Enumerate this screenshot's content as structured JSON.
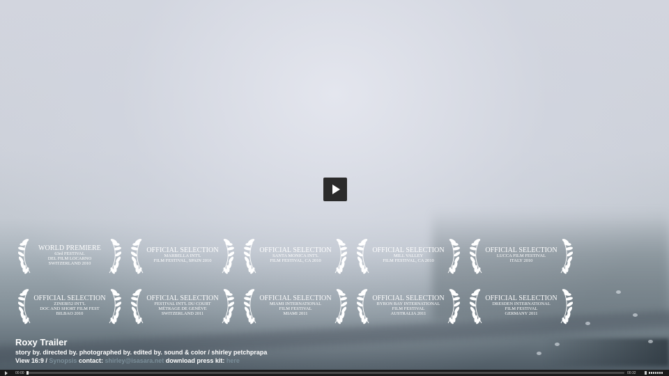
{
  "video": {
    "title": "Roxy Trailer",
    "credits": "story by. directed by. photographed by. edited by. sound & color / shirley petchprapa",
    "view_label": "View 16:9",
    "separator": "/",
    "synopsis_link": "Synopsis",
    "contact_label": "contact:",
    "contact_email": "shirley@isasara.net",
    "presskit_label": "download press kit:",
    "presskit_link": "here"
  },
  "laurels": [
    {
      "head": "WORLD PREMIERE",
      "lines": [
        "63rd FESTIVAL",
        "DEL FILM LOCARNO",
        "SWITZERLAND 2010"
      ]
    },
    {
      "head": "OFFICIAL SELECTION",
      "lines": [
        "MARBELLA INT'L",
        "FILM FESTIVAL, SPAIN 2010"
      ]
    },
    {
      "head": "OFFICIAL SELECTION",
      "lines": [
        "SANTA MONICA INT'L",
        "FILM FESTIVAL, CA 2010"
      ]
    },
    {
      "head": "OFFICIAL SELECTION",
      "lines": [
        "MILL VALLEY",
        "FILM FESTIVAL, CA 2010"
      ]
    },
    {
      "head": "OFFICIAL SELECTION",
      "lines": [
        "LUCCA FILM FESTIVAL",
        "ITALY 2010"
      ]
    },
    {
      "head": "OFFICIAL SELECTION",
      "lines": [
        "ZINEBI52 INT'L",
        "DOC AND SHORT FILM FEST",
        "BILBAO 2010"
      ]
    },
    {
      "head": "OFFICIAL SELECTION",
      "lines": [
        "FESTIVAL INT'L DU COURT",
        "MÉTRAGE DE GENÈVE",
        "SWITZERLAND 2011"
      ]
    },
    {
      "head": "OFFICIAL SELECTION",
      "lines": [
        "MIAMI INTERNATIONAL",
        "FILM FESTIVAL",
        "MIAMI 2011"
      ]
    },
    {
      "head": "OFFICIAL SELECTION",
      "lines": [
        "BYRON BAY INTERNATIONAL",
        "FILM FESTIVAL",
        "AUSTRALIA 2011"
      ]
    },
    {
      "head": "OFFICIAL SELECTION",
      "lines": [
        "DRESDEN INTERNATIONAL",
        "FILM FESTIVAL",
        "GERMANY 2011"
      ]
    }
  ],
  "player": {
    "current_time": "00:00",
    "total_time": "00:32",
    "progress": 0.0,
    "play_icon": "play-icon",
    "volume_icon": "volume-icon"
  },
  "colors": {
    "link_dim": "#7b8e99",
    "control_bar": "#1a1a1a",
    "play_button_bg": "#2b2b2b"
  }
}
